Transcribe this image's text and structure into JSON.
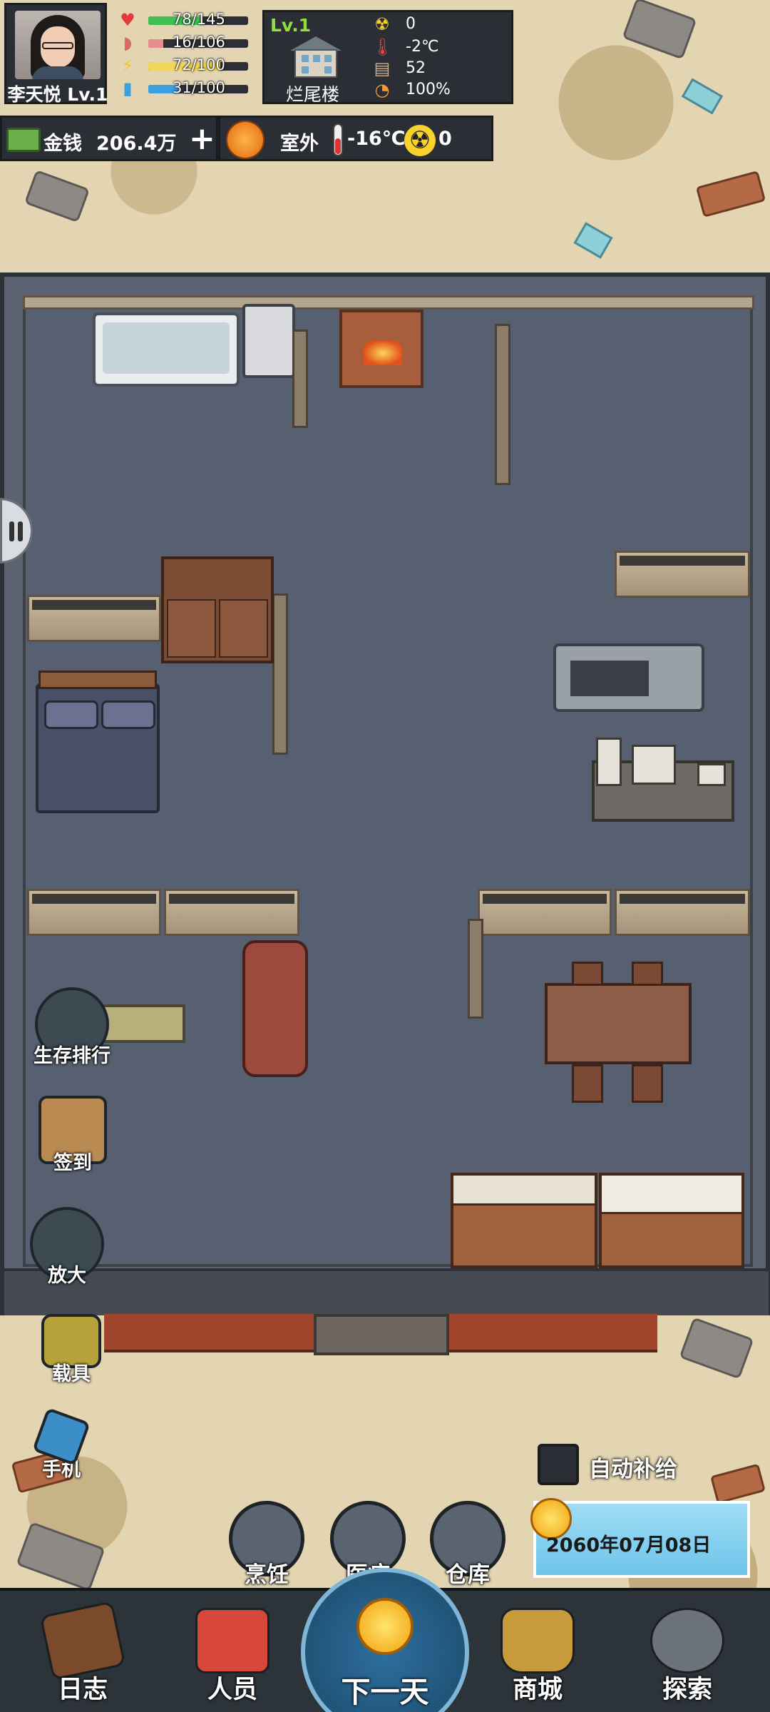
{
  "player": {
    "name": "李天悦 Lv.1"
  },
  "stats": [
    {
      "key": "health",
      "icon": "heart-icon",
      "glyph": "♥",
      "color": "#e23b3b",
      "bar_color": "#3fbf4f",
      "text": "78/145",
      "fraction": 0.54
    },
    {
      "key": "hunger",
      "icon": "stomach-icon",
      "glyph": "◗",
      "color": "#d96a6a",
      "bar_color": "#e88d8d",
      "text": "16/106",
      "fraction": 0.15
    },
    {
      "key": "energy",
      "icon": "lightning-icon",
      "glyph": "⚡",
      "color": "#f2c230",
      "bar_color": "#f2d65a",
      "text": "72/100",
      "fraction": 0.72
    },
    {
      "key": "thirst",
      "icon": "water-cup-icon",
      "glyph": "▮",
      "color": "#3aa0e0",
      "bar_color": "#3aa0e0",
      "text": "31/100",
      "fraction": 0.31
    }
  ],
  "building": {
    "level": "Lv.1",
    "name": "烂尾楼",
    "radiation": "0",
    "temperature": "-2℃",
    "materials": "52",
    "durability": "100%"
  },
  "resources": {
    "money_label": "金钱",
    "money_value": "206.4万",
    "plus": "+"
  },
  "weather": {
    "location": "室外",
    "temperature": "-16℃",
    "radiation": "0"
  },
  "side_buttons": {
    "ranking": "生存排行",
    "checkin": "签到",
    "zoom": "放大",
    "vehicle": "载具",
    "phone": "手机"
  },
  "auto_supply": {
    "label": "自动补给",
    "checked": false
  },
  "date": "2060年07月08日",
  "actions": {
    "cook": "烹饪",
    "medical": "医疗",
    "storage": "仓库"
  },
  "nav": {
    "log": "日志",
    "people": "人员",
    "next_day": "下一天",
    "shop": "商城",
    "explore": "探索"
  },
  "colors": {
    "panel": "#2b2f35",
    "level_green": "#8ee03d",
    "floor": "#566070"
  }
}
